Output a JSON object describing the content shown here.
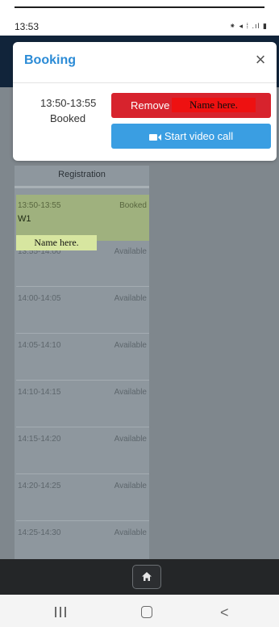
{
  "status_bar": {
    "time": "13:53",
    "icons": "⁕ ◂ ⁞ .ıl ▮"
  },
  "modal": {
    "title": "Booking",
    "close_icon": "×",
    "slot_time": "13:50-13:55",
    "slot_status": "Booked",
    "remove_label": "Remove",
    "redacted_name": "Name here.",
    "video_call_label": "Start video call"
  },
  "schedule": {
    "header": "Registration",
    "slots": [
      {
        "time": "13:50-13:55",
        "status": "Booked",
        "label": "W1"
      },
      {
        "time": "13:55-14:00",
        "status": "Available"
      },
      {
        "time": "14:00-14:05",
        "status": "Available"
      },
      {
        "time": "14:05-14:10",
        "status": "Available"
      },
      {
        "time": "14:10-14:15",
        "status": "Available"
      },
      {
        "time": "14:15-14:20",
        "status": "Available"
      },
      {
        "time": "14:20-14:25",
        "status": "Available"
      },
      {
        "time": "14:25-14:30",
        "status": "Available"
      }
    ],
    "name_tag": "Name here."
  },
  "nav": {
    "back_glyph": "<"
  },
  "colors": {
    "accent_blue": "#2b8bd6",
    "remove_red": "#d7232d",
    "video_blue": "#3a9ee2",
    "booked_green": "#9fb17e"
  }
}
